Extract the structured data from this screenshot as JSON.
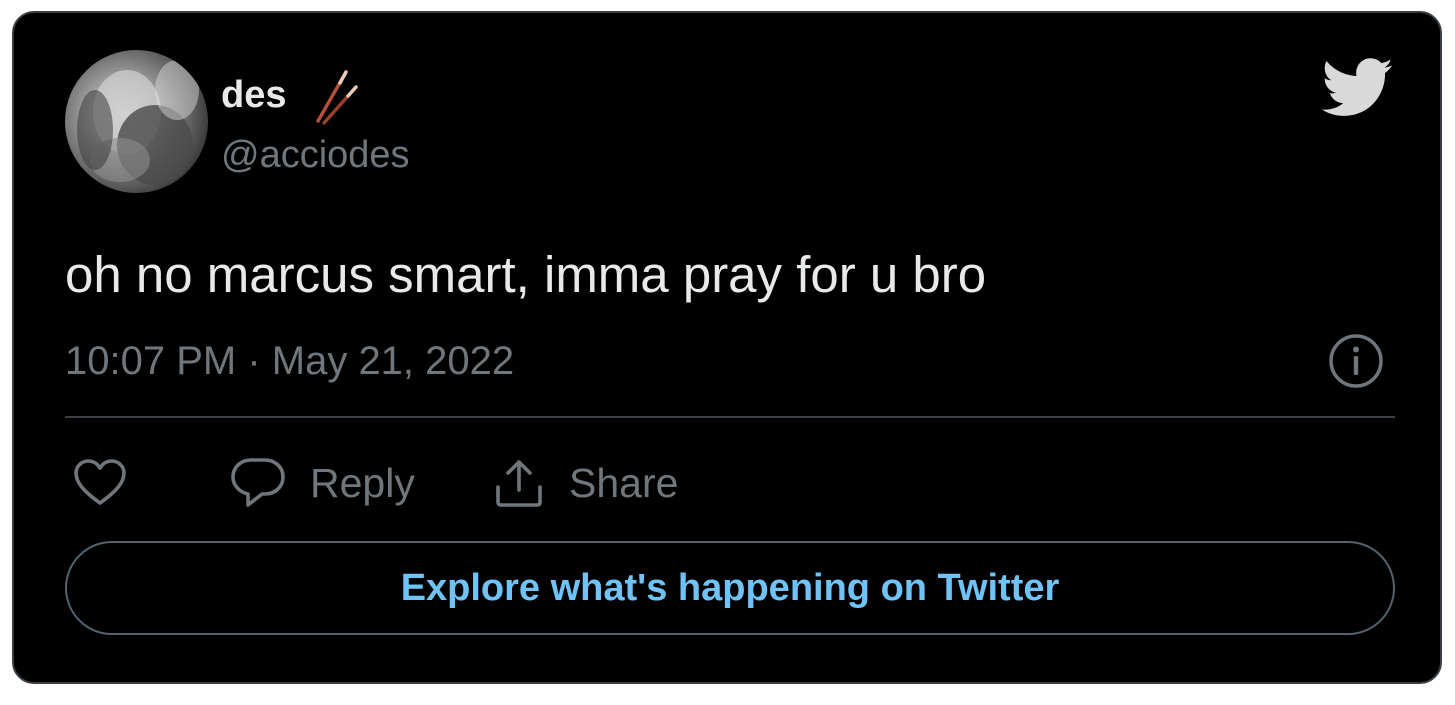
{
  "tweet": {
    "display_name": "des",
    "name_emoji": "chopsticks-icon",
    "handle": "@acciodes",
    "text": "oh no marcus smart, imma pray for u bro",
    "timestamp": "10:07 PM · May 21, 2022"
  },
  "actions": {
    "like_icon": "heart-icon",
    "reply_label": "Reply",
    "reply_icon": "speech-bubble-icon",
    "share_label": "Share",
    "share_icon": "share-upload-icon"
  },
  "explore_button": {
    "label": "Explore what's happening on Twitter"
  },
  "icons": {
    "brand": "twitter-bird-icon",
    "info": "info-icon"
  },
  "colors": {
    "background": "#000000",
    "primary_text": "#e7e9ea",
    "secondary_text": "#71767b",
    "link_blue": "#6fc3f7",
    "border": "#3a3f44",
    "twitter_logo": "#d9d9d9"
  }
}
